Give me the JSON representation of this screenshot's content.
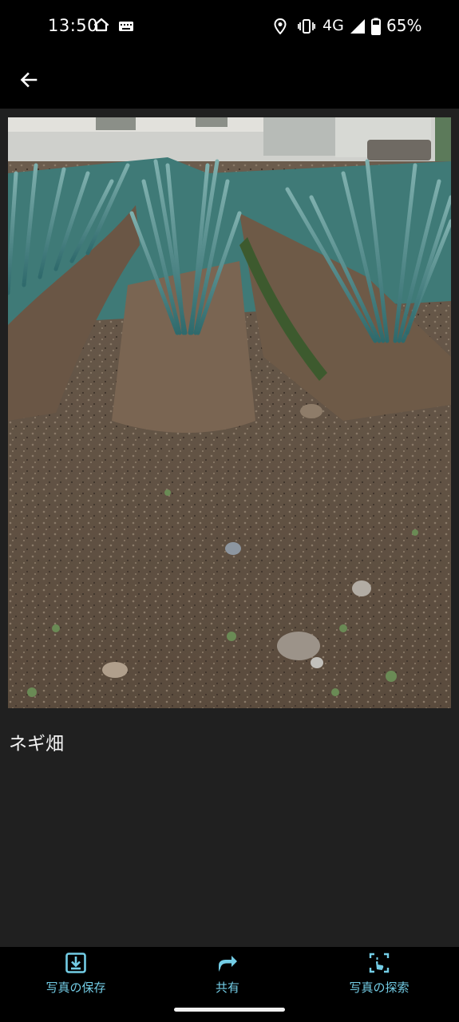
{
  "status_bar": {
    "time": "13:50",
    "network": "4G",
    "battery": "65%",
    "icons": [
      "home-icon",
      "keyboard-icon",
      "location-icon",
      "vibrate-icon",
      "signal-icon",
      "battery-icon"
    ]
  },
  "app_bar": {
    "back_icon": "arrow-left-icon"
  },
  "photo": {
    "subject": "ネギ畑"
  },
  "caption": "ネギ畑",
  "actions": [
    {
      "label": "写真の保存",
      "icon": "download-icon"
    },
    {
      "label": "共有",
      "icon": "share-icon"
    },
    {
      "label": "写真の探索",
      "icon": "explore-photo-icon"
    }
  ],
  "colors": {
    "accent": "#73cde6",
    "background": "#202020",
    "bars": "#000000"
  }
}
